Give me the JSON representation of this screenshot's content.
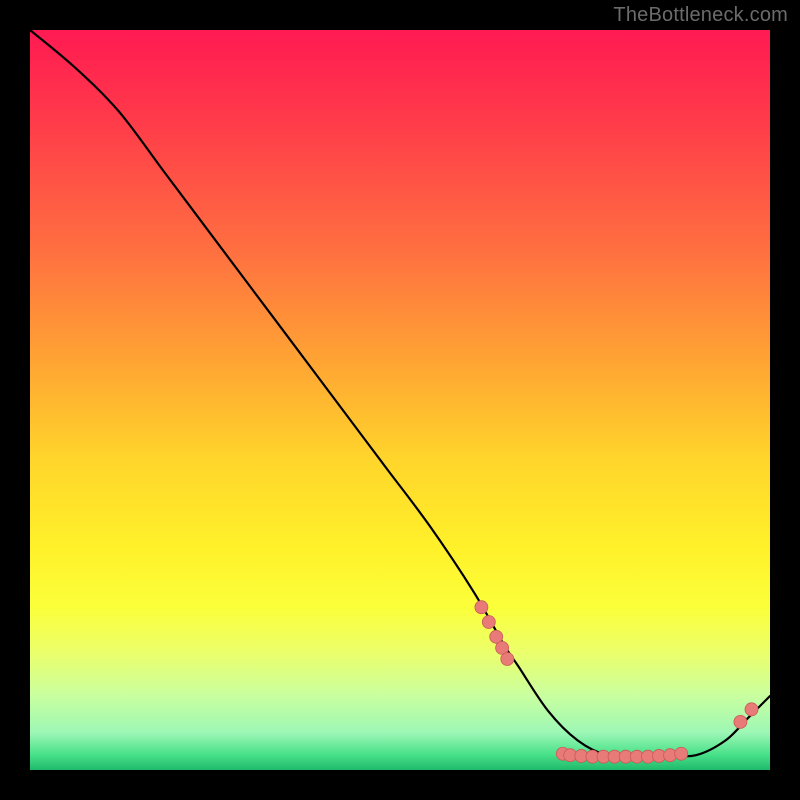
{
  "attribution": "TheBottleneck.com",
  "colors": {
    "background": "#000000",
    "attribution_text": "#6b6b6b",
    "curve": "#000000",
    "marker_fill": "#e87a78",
    "marker_stroke": "#c95a58"
  },
  "chart_data": {
    "type": "line",
    "title": "",
    "xlabel": "",
    "ylabel": "",
    "xlim": [
      0,
      100
    ],
    "ylim": [
      0,
      100
    ],
    "grid": false,
    "legend": false,
    "series": [
      {
        "name": "bottleneck-curve",
        "x": [
          0,
          6,
          12,
          18,
          24,
          30,
          36,
          42,
          48,
          54,
          60,
          64,
          66,
          70,
          74,
          78,
          82,
          86,
          90,
          94,
          97,
          100
        ],
        "y": [
          100,
          95,
          89,
          81,
          73,
          65,
          57,
          49,
          41,
          33,
          24,
          17,
          14,
          8,
          4,
          2,
          2,
          2,
          2,
          4,
          7,
          10
        ]
      }
    ],
    "markers": {
      "name": "highlighted-points",
      "points": [
        {
          "x": 61,
          "y": 22
        },
        {
          "x": 62,
          "y": 20
        },
        {
          "x": 63,
          "y": 18
        },
        {
          "x": 63.8,
          "y": 16.5
        },
        {
          "x": 64.5,
          "y": 15
        },
        {
          "x": 72,
          "y": 2.2
        },
        {
          "x": 73,
          "y": 2.0
        },
        {
          "x": 74.5,
          "y": 1.9
        },
        {
          "x": 76,
          "y": 1.8
        },
        {
          "x": 77.5,
          "y": 1.8
        },
        {
          "x": 79,
          "y": 1.8
        },
        {
          "x": 80.5,
          "y": 1.8
        },
        {
          "x": 82,
          "y": 1.8
        },
        {
          "x": 83.5,
          "y": 1.8
        },
        {
          "x": 85,
          "y": 1.9
        },
        {
          "x": 86.5,
          "y": 2.0
        },
        {
          "x": 88,
          "y": 2.2
        },
        {
          "x": 96,
          "y": 6.5
        },
        {
          "x": 97.5,
          "y": 8.2
        }
      ]
    }
  }
}
